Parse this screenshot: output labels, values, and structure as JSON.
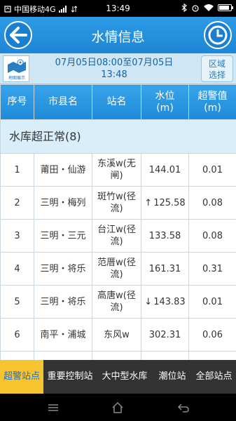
{
  "status_bar": {
    "carrier": "中国移动4G",
    "time": "13:49",
    "battery_level": 0.85
  },
  "header": {
    "title": "水情信息"
  },
  "info_bar": {
    "map_label": "地图展示",
    "range_start": "07月05日08:00至07月05日",
    "range_end": "13:48",
    "region_button_line1": "区域",
    "region_button_line2": "选择"
  },
  "table": {
    "columns": [
      "序号",
      "市县名",
      "站名",
      "水位(m)",
      "超警值(m)"
    ],
    "column_lines": [
      [
        "序号"
      ],
      [
        "市县名"
      ],
      [
        "站名"
      ],
      [
        "水位",
        "(m)"
      ],
      [
        "超警值",
        "(m)"
      ]
    ],
    "group_label": "水库超正常(8)",
    "rows": [
      {
        "no": "1",
        "county": "莆田・仙游",
        "station": "东溪w(无闸)",
        "trend": "",
        "level": "144.01",
        "over": "0.01"
      },
      {
        "no": "2",
        "county": "三明・梅列",
        "station": "斑竹w(径流)",
        "trend": "↑",
        "level": "125.58",
        "over": "0.08"
      },
      {
        "no": "3",
        "county": "三明・三元",
        "station": "台江w(径流)",
        "trend": "",
        "level": "133.58",
        "over": "0.08"
      },
      {
        "no": "4",
        "county": "三明・将乐",
        "station": "范厝w(径流)",
        "trend": "",
        "level": "161.31",
        "over": "0.31"
      },
      {
        "no": "5",
        "county": "三明・将乐",
        "station": "高唐w(径流)",
        "trend": "↓",
        "level": "143.83",
        "over": "0.01"
      },
      {
        "no": "6",
        "county": "南平・浦城",
        "station": "东风w",
        "trend": "",
        "level": "302.31",
        "over": "0.06"
      },
      {
        "no": "",
        "county": "",
        "station": "",
        "trend": "",
        "level": "",
        "over": ""
      }
    ]
  },
  "tabs": [
    {
      "label": "超警站点",
      "active": true
    },
    {
      "label": "重要控制站",
      "active": false
    },
    {
      "label": "大中型水库",
      "active": false
    },
    {
      "label": "潮位站",
      "active": false
    },
    {
      "label": "全部站点",
      "active": false
    }
  ],
  "colors": {
    "header_blue": "#1d86d6",
    "active_tab": "#f7c42e",
    "tab_bar": "#333333"
  },
  "icons": [
    "back-arrow-icon",
    "clock-icon",
    "map-icon",
    "menu-icon",
    "home-icon",
    "back-icon"
  ]
}
